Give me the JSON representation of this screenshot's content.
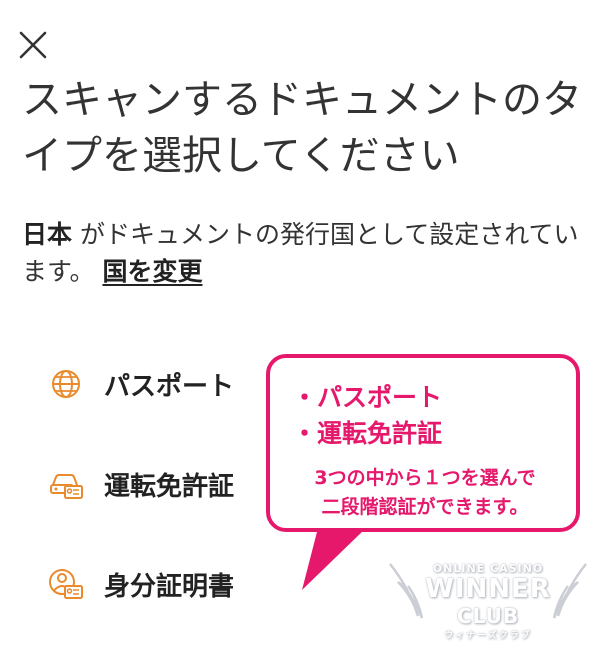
{
  "header": {
    "close_icon": "close-icon",
    "title": "スキャンするドキュメントのタイプを選択してください"
  },
  "notice": {
    "country": "日本",
    "text": " がドキュメントの発行国として設定されています。 ",
    "change_link": "国を変更"
  },
  "options": [
    {
      "icon": "globe-icon",
      "label": "パスポート"
    },
    {
      "icon": "car-license-icon",
      "label": "運転免許証"
    },
    {
      "icon": "id-card-icon",
      "label": "身分証明書"
    }
  ],
  "callout": {
    "bullets": [
      "・パスポート",
      "・運転免許証"
    ],
    "desc_line1": "3つの中から１つを選んで",
    "desc_line2": "二段階認証ができます。"
  },
  "watermark": {
    "top": "ONLINE CASINO",
    "main": "WINNER",
    "sub": "CLUB",
    "bottom": "ウィナーズクラブ"
  },
  "colors": {
    "accent_orange": "#e98a2c",
    "callout_pink": "#e6186c",
    "text_dark": "#222222"
  }
}
